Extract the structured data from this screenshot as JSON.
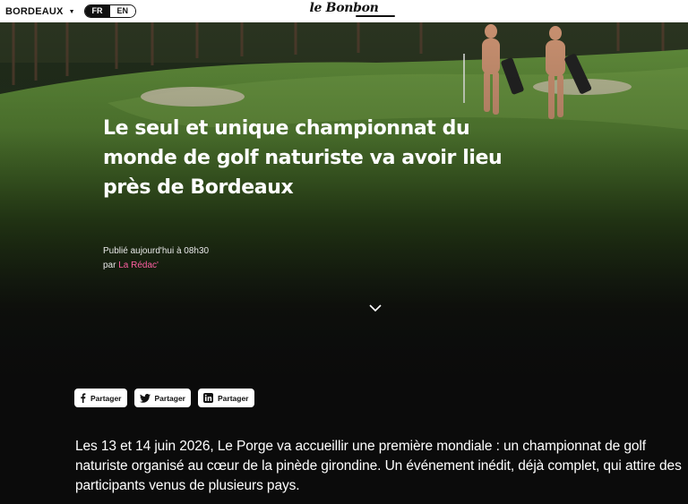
{
  "topbar": {
    "city": "BORDEAUX",
    "lang_active": "FR",
    "lang_inactive": "EN",
    "logo": "le Bonbon"
  },
  "article": {
    "title": "Le seul et unique championnat du monde de golf naturiste va avoir lieu près de Bordeaux",
    "published": "Publié aujourd'hui à 08h30",
    "by": "par",
    "author": "La Rédac'",
    "intro": "Les 13 et 14 juin 2026, Le Porge va accueillir une première mondiale : un championnat de golf naturiste organisé au cœur de la pinède girondine. Un événement inédit, déjà complet, qui attire des participants venus de plusieurs pays."
  },
  "share": {
    "facebook": "Partager",
    "twitter": "Partager",
    "linkedin": "Partager"
  },
  "colors": {
    "author_accent": "#ff5fa2",
    "background": "#0b0b0b"
  }
}
